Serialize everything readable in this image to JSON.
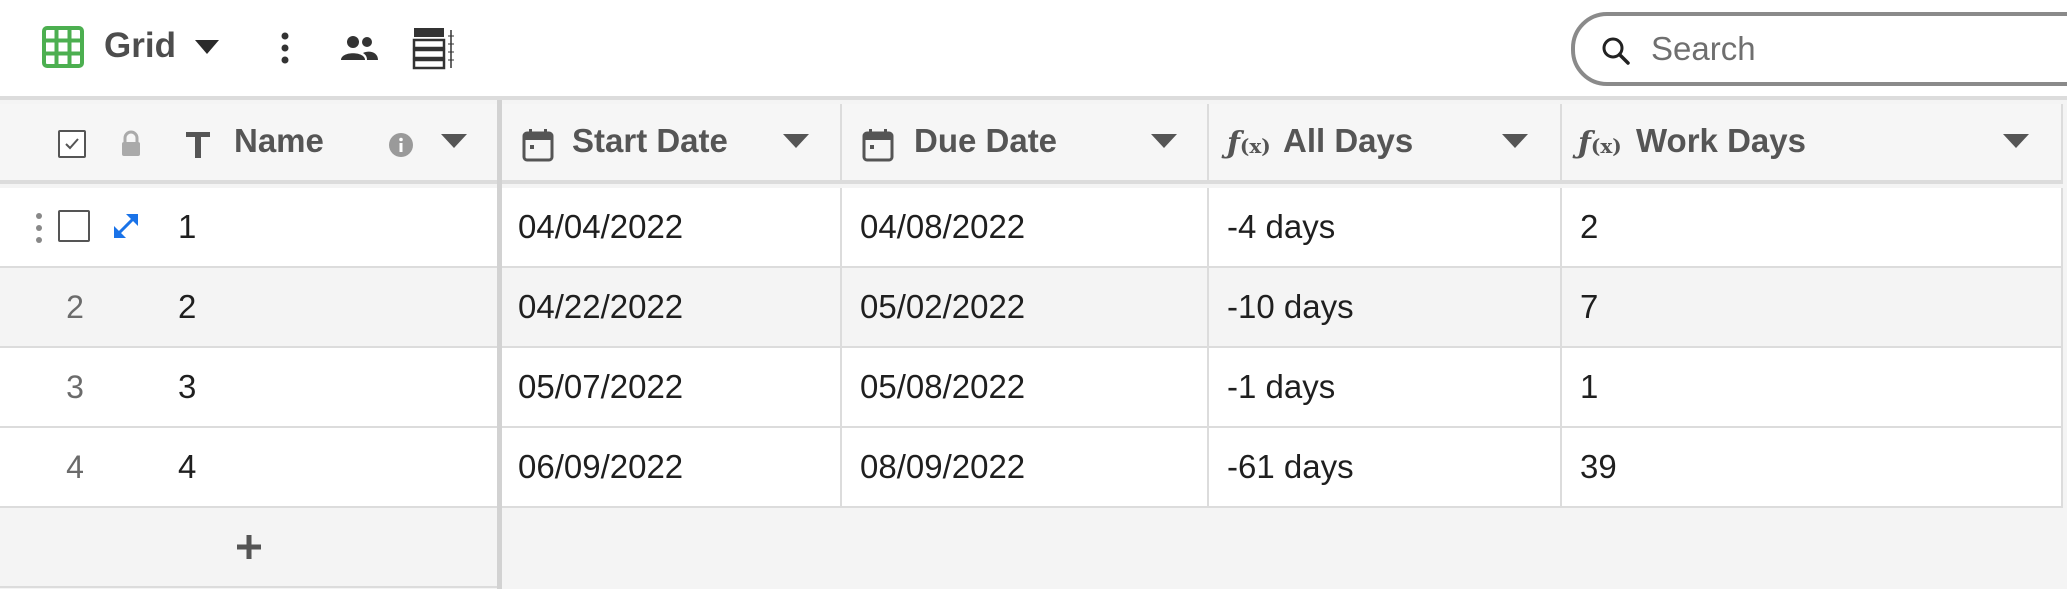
{
  "toolbar": {
    "view_name": "Grid",
    "view_icon": "grid-icon",
    "search_placeholder": "Search",
    "accent_color": "#4caf50"
  },
  "columns": [
    {
      "label": "Name",
      "icon": "text-type-icon"
    },
    {
      "label": "Start Date",
      "icon": "calendar-icon"
    },
    {
      "label": "Due Date",
      "icon": "calendar-icon"
    },
    {
      "label": "All Days",
      "icon": "formula-icon"
    },
    {
      "label": "Work Days",
      "icon": "formula-icon"
    }
  ],
  "rows": [
    {
      "num": "1",
      "name": "1",
      "start": "04/04/2022",
      "due": "04/08/2022",
      "all_days": "-4 days",
      "work_days": "2"
    },
    {
      "num": "2",
      "name": "2",
      "start": "04/22/2022",
      "due": "05/02/2022",
      "all_days": "-10 days",
      "work_days": "7"
    },
    {
      "num": "3",
      "name": "3",
      "start": "05/07/2022",
      "due": "05/08/2022",
      "all_days": "-1 days",
      "work_days": "1"
    },
    {
      "num": "4",
      "name": "4",
      "start": "06/09/2022",
      "due": "08/09/2022",
      "all_days": "-61 days",
      "work_days": "39"
    }
  ],
  "selection_color": "#1a73e8"
}
